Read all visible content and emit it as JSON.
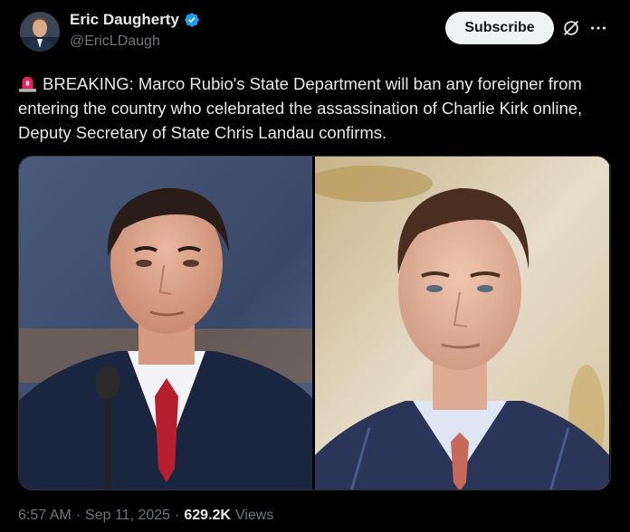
{
  "author": {
    "display_name": "Eric Daugherty",
    "handle": "@EricLDaugh",
    "verified": true,
    "verified_color": "#1d9bf0"
  },
  "actions": {
    "subscribe_label": "Subscribe",
    "grok_icon": "grok-slash-icon",
    "more_icon": "more-horizontal-icon"
  },
  "tweet": {
    "emoji": "police-siren-icon",
    "text": "BREAKING: Marco Rubio's State Department will ban any foreigner from entering the country who celebrated the assassination of Charlie Kirk online, Deputy Secretary of State Chris Landau confirms."
  },
  "meta": {
    "time": "6:57 AM",
    "separator1": "·",
    "date": "Sep 11, 2025",
    "separator2": "·",
    "views_count": "629.2K",
    "views_label": "Views"
  },
  "colors": {
    "background": "#000000",
    "text": "#e7e9ea",
    "muted": "#71767b",
    "button_bg": "#eff3f4",
    "siren_red": "#e0245e"
  }
}
